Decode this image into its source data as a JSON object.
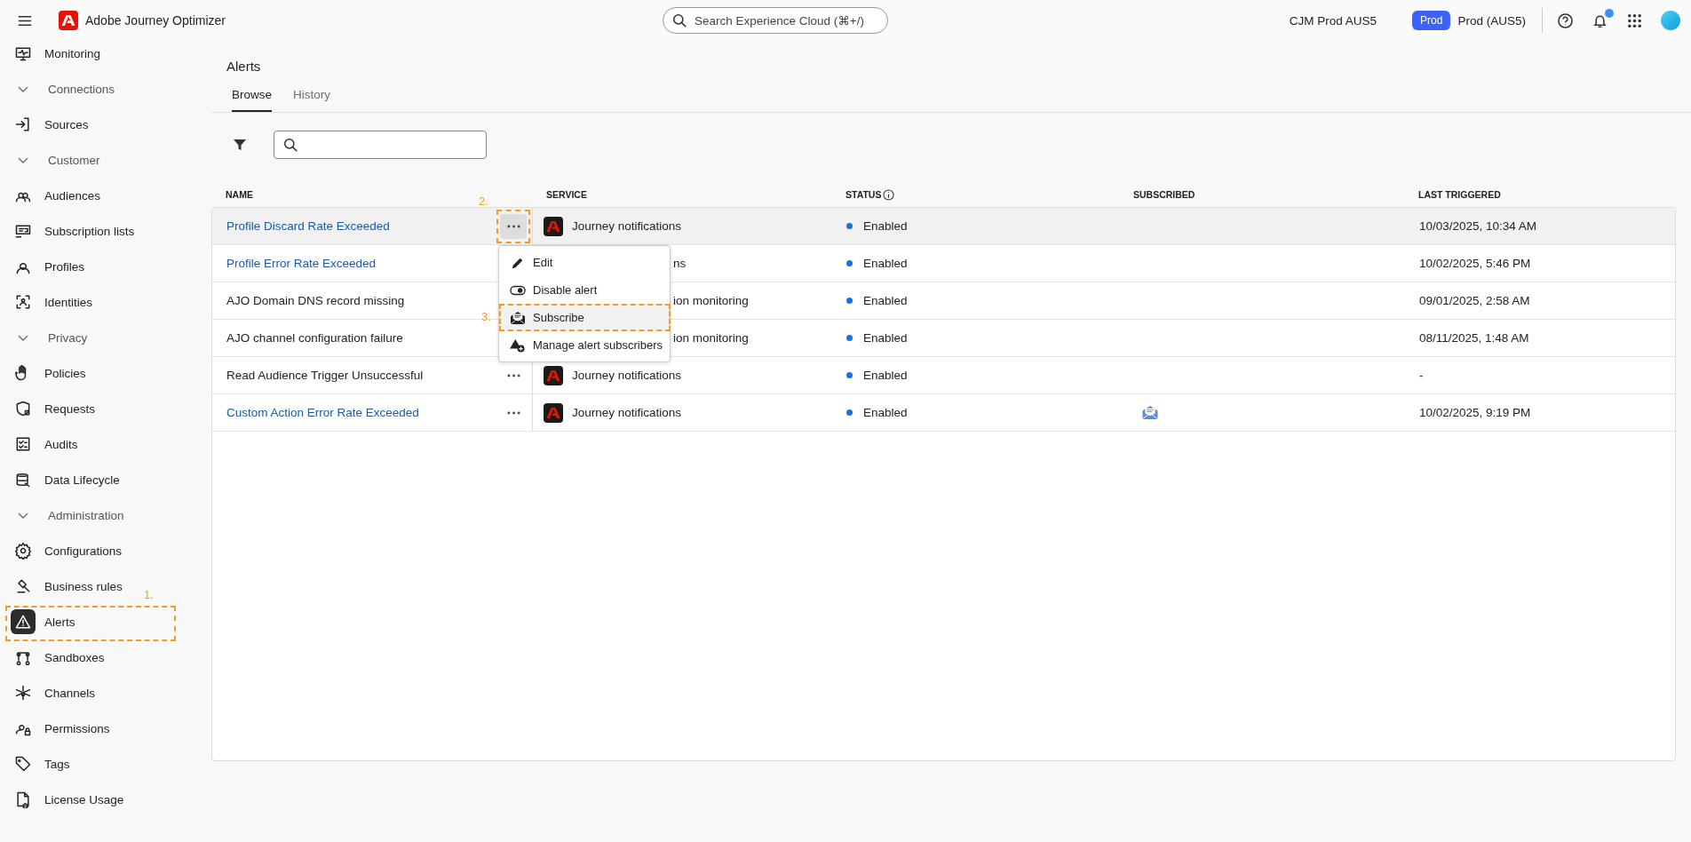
{
  "header": {
    "app_name": "Adobe Journey Optimizer",
    "search": {
      "placeholder": "Search Experience Cloud (⌘+/)"
    },
    "org": "CJM Prod AUS5",
    "env_badge": "Prod",
    "sandbox": "Prod (AUS5)",
    "notification_dot": true
  },
  "sidebar": [
    {
      "kind": "item",
      "label": "Monitoring",
      "selected": false
    },
    {
      "kind": "section",
      "label": "Connections",
      "expanded": true,
      "children": [
        {
          "label": "Sources",
          "selected": false
        }
      ]
    },
    {
      "kind": "section",
      "label": "Customer",
      "expanded": true,
      "children": [
        {
          "label": "Audiences",
          "selected": false
        },
        {
          "label": "Subscription lists",
          "selected": false
        },
        {
          "label": "Profiles",
          "selected": false
        },
        {
          "label": "Identities",
          "selected": false
        }
      ]
    },
    {
      "kind": "section",
      "label": "Privacy",
      "expanded": true,
      "children": [
        {
          "label": "Policies",
          "selected": false
        },
        {
          "label": "Requests",
          "selected": false
        },
        {
          "label": "Audits",
          "selected": false
        },
        {
          "label": "Data Lifecycle",
          "selected": false
        }
      ]
    },
    {
      "kind": "section",
      "label": "Administration",
      "expanded": true,
      "children": [
        {
          "label": "Configurations",
          "selected": false
        },
        {
          "label": "Business rules",
          "selected": false
        },
        {
          "label": "Alerts",
          "selected": true,
          "callout": "1."
        },
        {
          "label": "Sandboxes",
          "selected": false
        },
        {
          "label": "Channels",
          "selected": false
        },
        {
          "label": "Permissions",
          "selected": false
        },
        {
          "label": "Tags",
          "selected": false
        },
        {
          "label": "License Usage",
          "selected": false
        }
      ]
    }
  ],
  "page": {
    "title": "Alerts",
    "tabs": [
      {
        "label": "Browse",
        "selected": true
      },
      {
        "label": "History",
        "selected": false
      }
    ]
  },
  "table": {
    "columns": [
      "NAME",
      "SERVICE",
      "STATUS",
      "SUBSCRIBED",
      "LAST TRIGGERED"
    ],
    "rows": [
      {
        "name": "Profile Discard Rate Exceeded",
        "link": true,
        "highlighted": true,
        "more_button": true,
        "callout": "2.",
        "service": "Journey notifications",
        "service_icon": true,
        "covered": false,
        "status": "Enabled",
        "subscribed": false,
        "last_triggered": "10/03/2025, 10:34 AM"
      },
      {
        "name": "Profile Error Rate Exceeded",
        "link": true,
        "highlighted": false,
        "more_button": false,
        "service": "ns",
        "service_icon": false,
        "covered": true,
        "status": "Enabled",
        "subscribed": false,
        "last_triggered": "10/02/2025, 5:46 PM"
      },
      {
        "name": "AJO Domain DNS record missing",
        "link": false,
        "highlighted": false,
        "more_button": false,
        "service": "ion monitoring",
        "service_icon": false,
        "covered": true,
        "status": "Enabled",
        "subscribed": false,
        "last_triggered": "09/01/2025, 2:58 AM"
      },
      {
        "name": "AJO channel configuration failure",
        "link": false,
        "highlighted": false,
        "more_button": false,
        "service": "ion monitoring",
        "service_icon": false,
        "covered": true,
        "status": "Enabled",
        "subscribed": false,
        "last_triggered": "08/11/2025, 1:48 AM"
      },
      {
        "name": "Read Audience Trigger Unsuccessful",
        "link": false,
        "highlighted": false,
        "more_button": true,
        "service": "Journey notifications",
        "service_icon": true,
        "covered": false,
        "status": "Enabled",
        "subscribed": false,
        "last_triggered": "-"
      },
      {
        "name": "Custom Action Error Rate Exceeded",
        "link": true,
        "highlighted": false,
        "more_button": true,
        "service": "Journey notifications",
        "service_icon": true,
        "covered": false,
        "status": "Enabled",
        "subscribed": true,
        "last_triggered": "10/02/2025, 9:19 PM"
      }
    ]
  },
  "context_menu": {
    "items": [
      {
        "kind": "edit",
        "label": "Edit",
        "highlighted": false
      },
      {
        "kind": "toggle",
        "label": "Disable alert",
        "highlighted": false
      },
      {
        "kind": "subscribe",
        "label": "Subscribe",
        "highlighted": true,
        "callout": "3."
      },
      {
        "kind": "manage",
        "label": "Manage alert subscribers",
        "highlighted": false
      }
    ]
  }
}
